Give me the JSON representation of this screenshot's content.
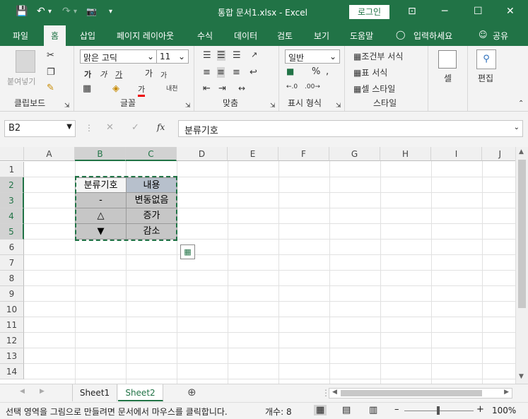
{
  "titlebar": {
    "title": "통합 문서1.xlsx  -  Excel",
    "login_label": "로그인",
    "save_icon": "💾",
    "undo_icon": "↶",
    "redo_icon": "↷",
    "camera_icon": "📷",
    "qa_more": "▾",
    "ribbon_display_icon": "⊡",
    "minimize": "─",
    "maximize": "☐",
    "close": "✕"
  },
  "tabs": [
    {
      "label": "파일"
    },
    {
      "label": "홈"
    },
    {
      "label": "삽입"
    },
    {
      "label": "페이지 레이아웃"
    },
    {
      "label": "수식"
    },
    {
      "label": "데이터"
    },
    {
      "label": "검토"
    },
    {
      "label": "보기"
    },
    {
      "label": "도움말"
    },
    {
      "label": "입력하세요"
    },
    {
      "label": "공유"
    }
  ],
  "ribbon": {
    "clipboard": {
      "paste": "붙여넣기",
      "label": "클립보드"
    },
    "font": {
      "name": "맑은 고딕",
      "size": "11",
      "label": "글꼴",
      "bold": "가",
      "italic": "가",
      "underline": "가",
      "grow": "가",
      "shrink": "가",
      "font_color": "가",
      "phonetic": "내천"
    },
    "align": {
      "label": "맞춤"
    },
    "number": {
      "format": "일반",
      "label": "표시 형식",
      "percent": "%",
      "comma": ","
    },
    "styles": {
      "conditional": "조건부 서식",
      "table": "표 서식",
      "cell": "셀 스타일",
      "label": "스타일"
    },
    "cells": {
      "label": "셀"
    },
    "edit": {
      "label": "편집"
    }
  },
  "formula_bar": {
    "name_box": "B2",
    "cancel": "✕",
    "enter": "✓",
    "fx": "fx",
    "value": "분류기호"
  },
  "columns": [
    "A",
    "B",
    "C",
    "D",
    "E",
    "F",
    "G",
    "H",
    "I",
    "J"
  ],
  "rows": [
    "1",
    "2",
    "3",
    "4",
    "5",
    "6",
    "7",
    "8",
    "9",
    "10",
    "11",
    "12",
    "13",
    "14"
  ],
  "cells": {
    "B2": "분류기호",
    "C2": "내용",
    "B3": "-",
    "C3": "변동없음",
    "B4": "△",
    "C4": "증가",
    "B5": "▼",
    "C5": "감소"
  },
  "sheets": [
    {
      "name": "Sheet1"
    },
    {
      "name": "Sheet2"
    }
  ],
  "status": {
    "message": "선택 영역을 그림으로 만들려면 문서에서 마우스를 클릭합니다.",
    "count": "개수: 8",
    "zoom": "100%"
  }
}
